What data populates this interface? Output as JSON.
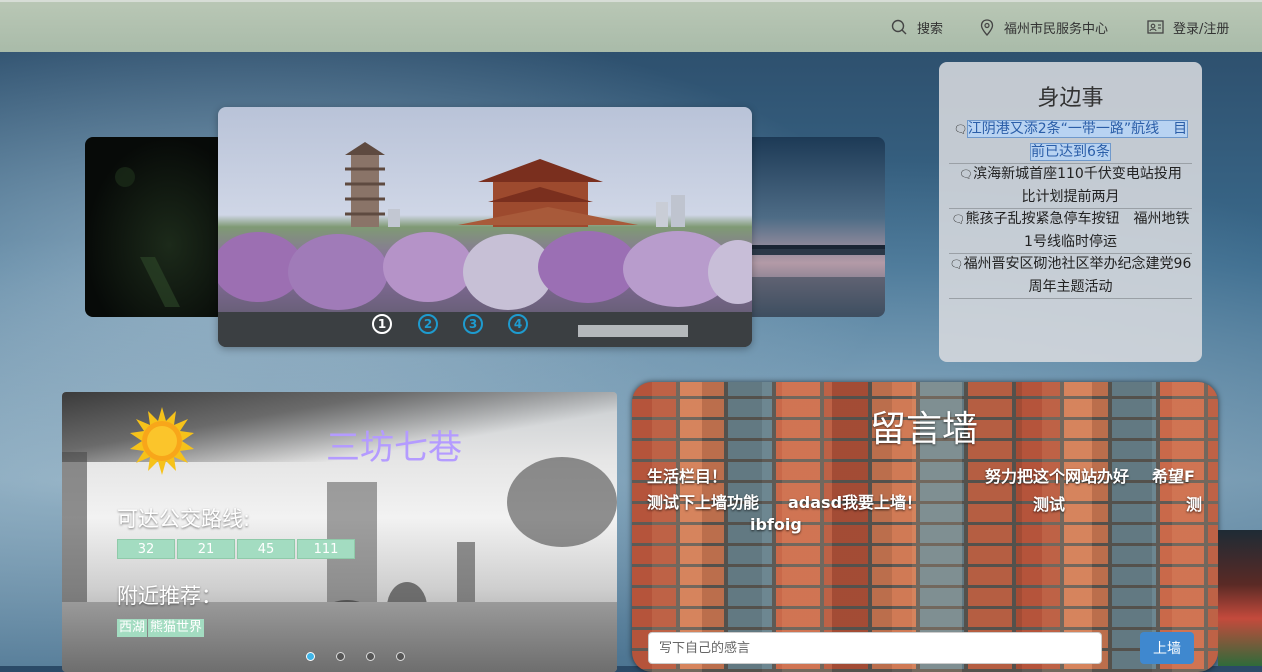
{
  "nav": {
    "search_label": "搜索",
    "location_label": "福州市民服务中心",
    "login_label": "登录/注册"
  },
  "carousel": {
    "indicators": [
      "1",
      "2",
      "3",
      "4"
    ],
    "active_index": 1
  },
  "news": {
    "title": "身边事",
    "items": [
      "江阴港又添2条“一带一路”航线　目前已达到6条",
      "滨海新城首座110千伏变电站投用　比计划提前两月",
      "熊孩子乱按紧急停车按钮　福州地铁1号线临时停运",
      "福州晋安区砌池社区举办纪念建党96周年主题活动"
    ],
    "selected_index": 0
  },
  "scenic": {
    "title": "三坊七巷",
    "bus_label": "可达公交路线:",
    "bus_routes": [
      "32",
      "21",
      "45",
      "111"
    ],
    "recommend_label": "附近推荐：",
    "recommend_tags": [
      "西湖",
      "熊猫世界"
    ],
    "slide_count": 4,
    "active_slide": 1
  },
  "wall": {
    "title": "留言墙",
    "messages": [
      "生活栏目！",
      "努力把这个网站办好",
      "希望F",
      "测试下上墙功能",
      "adasd我要上墙！",
      "测试",
      "测",
      "ibfoig"
    ],
    "input_placeholder": "写下自己的感言",
    "submit_label": "上墙"
  },
  "colors": {
    "topbar": "#afc0ad",
    "accent_blue": "#3f88cf",
    "indicator_blue": "#1e9bcf",
    "route_tag": "#a3dcc1",
    "scenic_title": "#b49bff"
  }
}
